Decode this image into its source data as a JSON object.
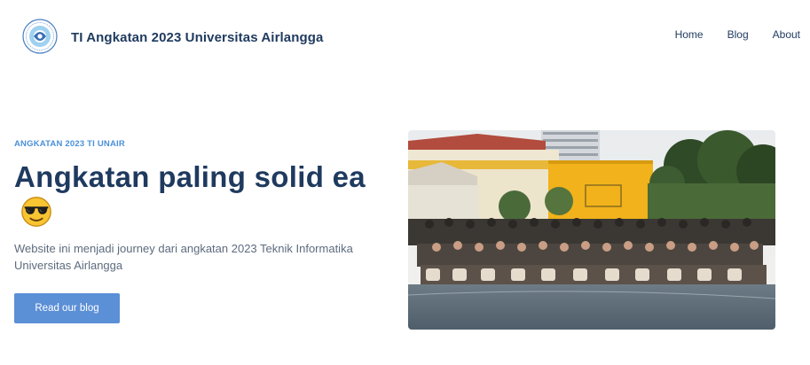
{
  "navbar": {
    "brand": "TI Angkatan 2023 Universitas Airlangga",
    "logo_icon": "university-seal-icon",
    "links": [
      {
        "label": "Home"
      },
      {
        "label": "Blog"
      },
      {
        "label": "About"
      }
    ]
  },
  "hero": {
    "eyebrow": "ANGKATAN 2023 TI UNAIR",
    "headline": "Angkatan paling solid ea",
    "headline_emoji": "sunglasses-emoji-icon",
    "subtext": "Website ini menjadi journey dari angkatan 2023 Teknik Informatika Universitas Airlangga",
    "cta_label": "Read our blog",
    "image_icon": "group-photo-icon"
  },
  "colors": {
    "primary_text": "#1f3a5f",
    "accent": "#4a90d9",
    "button": "#5b8fd6",
    "body_text": "#5d6b7e"
  }
}
